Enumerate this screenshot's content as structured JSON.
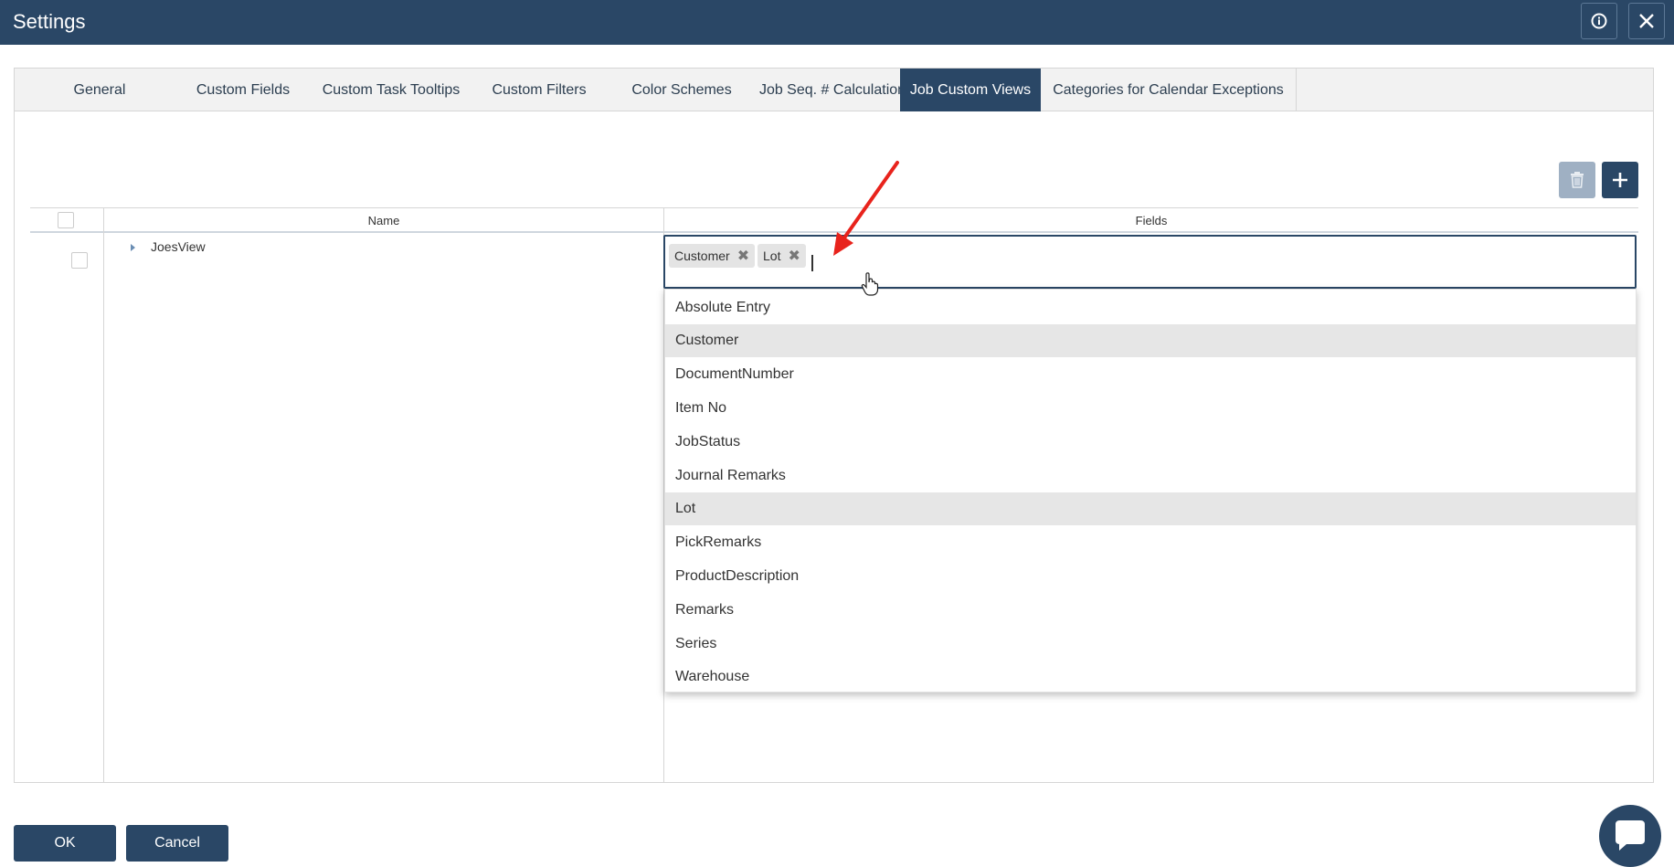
{
  "window": {
    "title": "Settings",
    "info_icon": "info-icon",
    "close_icon": "close-icon"
  },
  "tabs": [
    {
      "label": "General",
      "active": false
    },
    {
      "label": "Custom Fields",
      "active": false
    },
    {
      "label": "Custom Task Tooltips",
      "active": false
    },
    {
      "label": "Custom Filters",
      "active": false
    },
    {
      "label": "Color Schemes",
      "active": false
    },
    {
      "label": "Job Seq. # Calculation",
      "active": false
    },
    {
      "label": "Job Custom Views",
      "active": true
    },
    {
      "label": "Categories for Calendar Exceptions",
      "active": false
    }
  ],
  "toolbar": {
    "delete_icon": "trash-icon",
    "add_icon": "plus-icon"
  },
  "grid": {
    "columns": {
      "name": "Name",
      "fields": "Fields"
    },
    "rows": [
      {
        "name": "JoesView",
        "checked": false
      }
    ]
  },
  "fields_editor": {
    "chips": [
      "Customer",
      "Lot"
    ],
    "remove_glyph": "✖",
    "options": [
      {
        "label": "Absolute Entry",
        "selected": false
      },
      {
        "label": "Customer",
        "selected": true
      },
      {
        "label": "DocumentNumber",
        "selected": false
      },
      {
        "label": "Item No",
        "selected": false
      },
      {
        "label": "JobStatus",
        "selected": false
      },
      {
        "label": "Journal Remarks",
        "selected": false
      },
      {
        "label": "Lot",
        "selected": true
      },
      {
        "label": "PickRemarks",
        "selected": false
      },
      {
        "label": "ProductDescription",
        "selected": false
      },
      {
        "label": "Remarks",
        "selected": false
      },
      {
        "label": "Series",
        "selected": false
      },
      {
        "label": "Warehouse",
        "selected": false
      }
    ]
  },
  "footer": {
    "ok_label": "OK",
    "cancel_label": "Cancel",
    "chat_icon": "chat-icon"
  },
  "colors": {
    "primary": "#2a4766",
    "disabled": "#9fb0c3",
    "annotation_arrow": "#e8231c",
    "selected_row": "#e6e6e6"
  }
}
